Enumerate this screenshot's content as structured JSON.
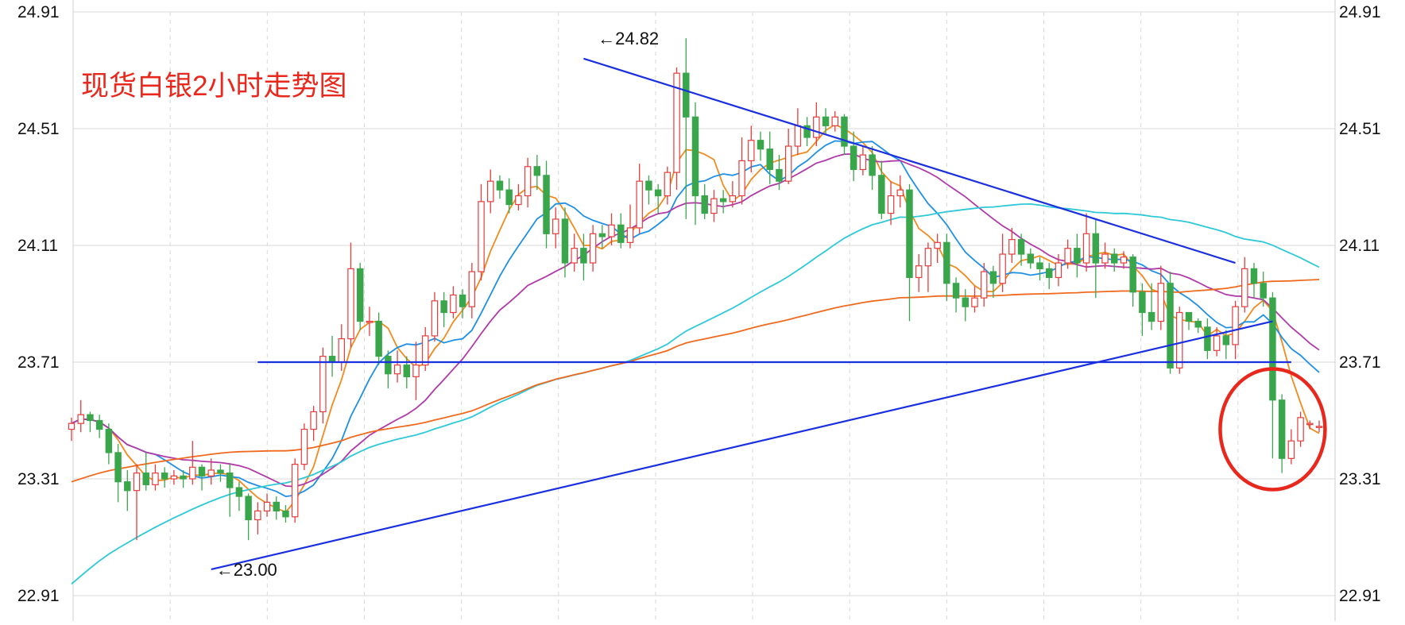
{
  "title": "现货白银2小时走势图",
  "colors": {
    "up": "#e63c3c",
    "down": "#3aa64c",
    "ma5": "#f28a1e",
    "ma10": "#1e90e6",
    "ma20": "#b03aa8",
    "ma60": "#2ec9d8",
    "ma120": "#f06a1e",
    "trendline": "#1a2fe0",
    "highlight": "#e8281d",
    "grid": "#d9d9d9"
  },
  "chart_data": {
    "type": "candlestick",
    "title": "现货白银2小时走势图",
    "ylim": [
      22.91,
      24.91
    ],
    "y_ticks_left": [
      "24.91",
      "24.51",
      "24.11",
      "23.71",
      "23.31",
      "22.91"
    ],
    "y_ticks_right": [
      "24.91",
      "24.51",
      "24.11",
      "23.71",
      "23.31",
      "22.91"
    ],
    "grid": true,
    "annotations": [
      {
        "text": "←24.82",
        "index": 56,
        "price": 24.82
      },
      {
        "text": "←23.00",
        "index": 15,
        "price": 23.0
      }
    ],
    "trendlines": [
      {
        "from": [
          55,
          24.75
        ],
        "to": [
          125,
          24.05
        ]
      },
      {
        "from": [
          15,
          23.0
        ],
        "to": [
          129,
          23.85
        ]
      },
      {
        "from": [
          20,
          23.71
        ],
        "to": [
          131,
          23.71
        ]
      }
    ],
    "highlight_circle": {
      "index": 129,
      "price": 23.48
    },
    "candles": [
      [
        23.48,
        23.5,
        23.44,
        23.52
      ],
      [
        23.5,
        23.53,
        23.47,
        23.58
      ],
      [
        23.53,
        23.51,
        23.47,
        23.54
      ],
      [
        23.51,
        23.48,
        23.45,
        23.53
      ],
      [
        23.48,
        23.4,
        23.36,
        23.5
      ],
      [
        23.4,
        23.3,
        23.23,
        23.43
      ],
      [
        23.3,
        23.27,
        23.2,
        23.34
      ],
      [
        23.27,
        23.33,
        23.1,
        23.36
      ],
      [
        23.33,
        23.29,
        23.27,
        23.4
      ],
      [
        23.29,
        23.33,
        23.27,
        23.36
      ],
      [
        23.33,
        23.31,
        23.28,
        23.35
      ],
      [
        23.31,
        23.32,
        23.29,
        23.34
      ],
      [
        23.32,
        23.31,
        23.28,
        23.34
      ],
      [
        23.31,
        23.35,
        23.29,
        23.44
      ],
      [
        23.35,
        23.32,
        23.27,
        23.36
      ],
      [
        23.32,
        23.34,
        23.29,
        23.38
      ],
      [
        23.34,
        23.33,
        23.3,
        23.36
      ],
      [
        23.33,
        23.28,
        23.18,
        23.36
      ],
      [
        23.28,
        23.25,
        23.2,
        23.3
      ],
      [
        23.25,
        23.17,
        23.1,
        23.26
      ],
      [
        23.17,
        23.2,
        23.12,
        23.23
      ],
      [
        23.2,
        23.23,
        23.18,
        23.26
      ],
      [
        23.23,
        23.2,
        23.17,
        23.25
      ],
      [
        23.2,
        23.18,
        23.16,
        23.22
      ],
      [
        23.18,
        23.36,
        23.16,
        23.38
      ],
      [
        23.36,
        23.48,
        23.34,
        23.5
      ],
      [
        23.48,
        23.54,
        23.44,
        23.56
      ],
      [
        23.54,
        23.73,
        23.5,
        23.76
      ],
      [
        23.73,
        23.71,
        23.66,
        23.8
      ],
      [
        23.71,
        23.79,
        23.68,
        23.84
      ],
      [
        23.79,
        24.03,
        23.76,
        24.12
      ],
      [
        24.03,
        23.85,
        23.82,
        24.05
      ],
      [
        23.85,
        23.85,
        23.8,
        23.9
      ],
      [
        23.85,
        23.73,
        23.7,
        23.88
      ],
      [
        23.73,
        23.67,
        23.62,
        23.75
      ],
      [
        23.67,
        23.7,
        23.64,
        23.75
      ],
      [
        23.7,
        23.66,
        23.62,
        23.73
      ],
      [
        23.66,
        23.7,
        23.58,
        23.78
      ],
      [
        23.7,
        23.8,
        23.68,
        23.83
      ],
      [
        23.8,
        23.92,
        23.78,
        23.95
      ],
      [
        23.92,
        23.88,
        23.83,
        23.95
      ],
      [
        23.88,
        23.94,
        23.86,
        23.97
      ],
      [
        23.94,
        23.9,
        23.86,
        23.96
      ],
      [
        23.9,
        24.02,
        23.86,
        24.05
      ],
      [
        24.02,
        24.26,
        23.99,
        24.32
      ],
      [
        24.26,
        24.33,
        24.22,
        24.37
      ],
      [
        24.33,
        24.3,
        24.27,
        24.35
      ],
      [
        24.3,
        24.25,
        24.22,
        24.34
      ],
      [
        24.25,
        24.28,
        24.23,
        24.32
      ],
      [
        24.28,
        24.38,
        24.24,
        24.41
      ],
      [
        24.38,
        24.35,
        24.3,
        24.42
      ],
      [
        24.35,
        24.15,
        24.1,
        24.4
      ],
      [
        24.15,
        24.2,
        24.1,
        24.24
      ],
      [
        24.2,
        24.05,
        24.0,
        24.24
      ],
      [
        24.05,
        24.1,
        24.02,
        24.15
      ],
      [
        24.1,
        24.05,
        23.99,
        24.15
      ],
      [
        24.05,
        24.15,
        24.02,
        24.18
      ],
      [
        24.15,
        24.14,
        24.1,
        24.18
      ],
      [
        24.14,
        24.18,
        24.11,
        24.22
      ],
      [
        24.18,
        24.12,
        24.1,
        24.22
      ],
      [
        24.12,
        24.17,
        24.1,
        24.25
      ],
      [
        24.17,
        24.33,
        24.15,
        24.39
      ],
      [
        24.33,
        24.3,
        24.25,
        24.35
      ],
      [
        24.3,
        24.28,
        24.22,
        24.32
      ],
      [
        24.28,
        24.36,
        24.25,
        24.38
      ],
      [
        24.36,
        24.7,
        24.3,
        24.72
      ],
      [
        24.7,
        24.55,
        24.2,
        24.82
      ],
      [
        24.55,
        24.28,
        24.18,
        24.6
      ],
      [
        24.28,
        24.22,
        24.2,
        24.32
      ],
      [
        24.22,
        24.27,
        24.19,
        24.3
      ],
      [
        24.27,
        24.26,
        24.22,
        24.3
      ],
      [
        24.26,
        24.28,
        24.24,
        24.33
      ],
      [
        24.28,
        24.4,
        24.25,
        24.48
      ],
      [
        24.4,
        24.47,
        24.36,
        24.52
      ],
      [
        24.47,
        24.44,
        24.4,
        24.5
      ],
      [
        24.44,
        24.37,
        24.32,
        24.5
      ],
      [
        24.37,
        24.33,
        24.3,
        24.42
      ],
      [
        24.33,
        24.45,
        24.32,
        24.51
      ],
      [
        24.45,
        24.52,
        24.42,
        24.58
      ],
      [
        24.52,
        24.48,
        24.45,
        24.55
      ],
      [
        24.48,
        24.55,
        24.45,
        24.6
      ],
      [
        24.55,
        24.52,
        24.49,
        24.58
      ],
      [
        24.52,
        24.55,
        24.5,
        24.57
      ],
      [
        24.55,
        24.45,
        24.42,
        24.56
      ],
      [
        24.45,
        24.37,
        24.33,
        24.5
      ],
      [
        24.37,
        24.42,
        24.35,
        24.45
      ],
      [
        24.42,
        24.35,
        24.3,
        24.45
      ],
      [
        24.35,
        24.22,
        24.2,
        24.4
      ],
      [
        24.22,
        24.28,
        24.18,
        24.33
      ],
      [
        24.28,
        24.3,
        24.24,
        24.35
      ],
      [
        24.3,
        24.0,
        23.85,
        24.32
      ],
      [
        24.0,
        24.04,
        23.95,
        24.08
      ],
      [
        24.04,
        24.1,
        23.95,
        24.12
      ],
      [
        24.1,
        24.12,
        24.05,
        24.15
      ],
      [
        24.12,
        23.98,
        23.92,
        24.15
      ],
      [
        23.98,
        23.93,
        23.88,
        24.0
      ],
      [
        23.93,
        23.9,
        23.85,
        23.96
      ],
      [
        23.9,
        23.93,
        23.88,
        23.97
      ],
      [
        23.93,
        24.02,
        23.9,
        24.05
      ],
      [
        24.02,
        23.98,
        23.93,
        24.04
      ],
      [
        23.98,
        24.08,
        23.95,
        24.15
      ],
      [
        24.08,
        24.13,
        24.05,
        24.17
      ],
      [
        24.13,
        24.08,
        24.04,
        24.15
      ],
      [
        24.08,
        24.05,
        24.03,
        24.1
      ],
      [
        24.05,
        24.03,
        23.99,
        24.07
      ],
      [
        24.03,
        24.0,
        23.96,
        24.05
      ],
      [
        24.0,
        24.05,
        23.97,
        24.08
      ],
      [
        24.05,
        24.1,
        24.03,
        24.13
      ],
      [
        24.1,
        24.05,
        24.0,
        24.15
      ],
      [
        24.05,
        24.15,
        24.02,
        24.22
      ],
      [
        24.15,
        24.05,
        23.93,
        24.2
      ],
      [
        24.05,
        24.08,
        24.03,
        24.12
      ],
      [
        24.08,
        24.05,
        24.02,
        24.1
      ],
      [
        24.05,
        24.07,
        24.03,
        24.09
      ],
      [
        24.07,
        23.95,
        23.9,
        24.08
      ],
      [
        23.95,
        23.88,
        23.8,
        23.98
      ],
      [
        23.88,
        23.85,
        23.82,
        23.98
      ],
      [
        23.85,
        23.98,
        23.82,
        24.04
      ],
      [
        23.98,
        23.69,
        23.67,
        24.02
      ],
      [
        23.69,
        23.88,
        23.67,
        23.9
      ],
      [
        23.88,
        23.85,
        23.82,
        23.88
      ],
      [
        23.85,
        23.83,
        23.81,
        23.86
      ],
      [
        23.83,
        23.75,
        23.72,
        23.86
      ],
      [
        23.75,
        23.8,
        23.73,
        23.83
      ],
      [
        23.8,
        23.77,
        23.72,
        23.82
      ],
      [
        23.77,
        23.9,
        23.72,
        23.92
      ],
      [
        23.9,
        24.03,
        23.88,
        24.07
      ],
      [
        24.03,
        23.98,
        23.93,
        24.05
      ],
      [
        23.98,
        23.93,
        23.9,
        24.02
      ],
      [
        23.93,
        23.58,
        23.38,
        23.95
      ],
      [
        23.58,
        23.38,
        23.33,
        23.6
      ],
      [
        23.38,
        23.44,
        23.36,
        23.48
      ],
      [
        23.44,
        23.52,
        23.42,
        23.54
      ],
      [
        23.5,
        23.5,
        23.48,
        23.51
      ],
      [
        23.49,
        23.49,
        23.47,
        23.51
      ]
    ]
  }
}
